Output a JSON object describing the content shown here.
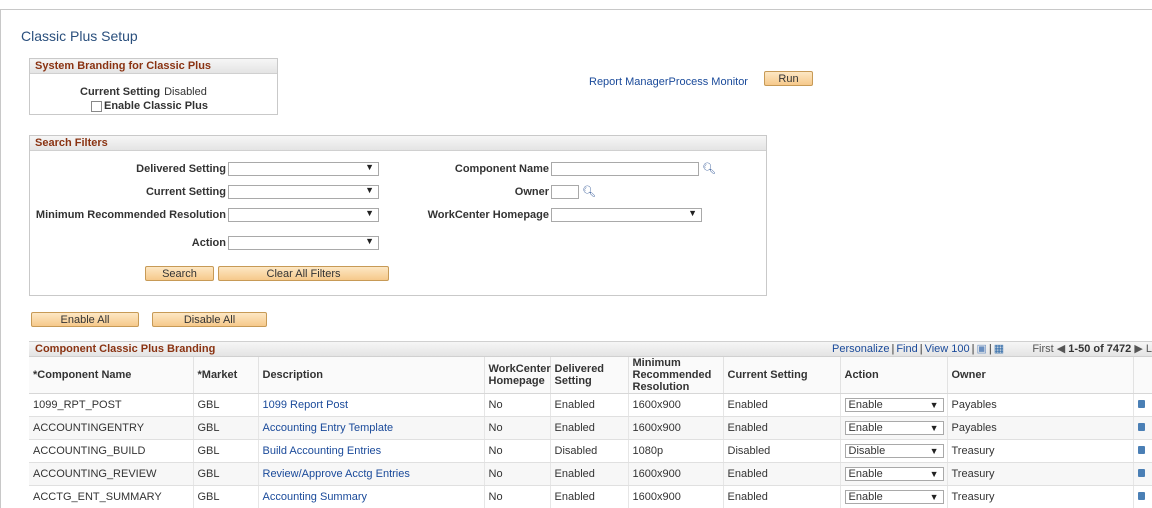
{
  "page": {
    "title": "Classic Plus Setup"
  },
  "branding": {
    "header": "System Branding for Classic Plus",
    "current_setting_label": "Current Setting",
    "current_setting_value": "Disabled",
    "enable_label": "Enable Classic Plus"
  },
  "links": {
    "report_manager": "Report Manager",
    "process_monitor": "Process Monitor"
  },
  "buttons": {
    "run": "Run",
    "search": "Search",
    "clear_all_filters": "Clear All Filters",
    "enable_all": "Enable All",
    "disable_all": "Disable All"
  },
  "filters": {
    "header": "Search Filters",
    "delivered_setting": "Delivered Setting",
    "current_setting": "Current Setting",
    "min_resolution": "Minimum Recommended Resolution",
    "action": "Action",
    "component_name": "Component Name",
    "owner": "Owner",
    "workcenter_homepage": "WorkCenter Homepage"
  },
  "grid": {
    "title": "Component Classic Plus Branding",
    "nav": {
      "personalize": "Personalize",
      "find": "Find",
      "view": "View 100",
      "first": "First",
      "range": "1-50 of 7472",
      "last": "L"
    },
    "columns": {
      "component_name": "*Component Name",
      "market": "*Market",
      "description": "Description",
      "workcenter_homepage": "WorkCenter Homepage",
      "delivered_setting": "Delivered Setting",
      "min_resolution": "Minimum Recommended Resolution",
      "current_setting": "Current Setting",
      "action": "Action",
      "owner": "Owner"
    },
    "rows": [
      {
        "component": "1099_RPT_POST",
        "market": "GBL",
        "description": "1099 Report Post",
        "workcenter": "No",
        "delivered": "Enabled",
        "resolution": "1600x900",
        "current": "Enabled",
        "action": "Enable",
        "owner": "Payables"
      },
      {
        "component": "ACCOUNTINGENTRY",
        "market": "GBL",
        "description": "Accounting Entry Template",
        "workcenter": "No",
        "delivered": "Enabled",
        "resolution": "1600x900",
        "current": "Enabled",
        "action": "Enable",
        "owner": "Payables"
      },
      {
        "component": "ACCOUNTING_BUILD",
        "market": "GBL",
        "description": "Build Accounting Entries",
        "workcenter": "No",
        "delivered": "Disabled",
        "resolution": "1080p",
        "current": "Disabled",
        "action": "Disable",
        "owner": "Treasury"
      },
      {
        "component": "ACCOUNTING_REVIEW",
        "market": "GBL",
        "description": "Review/Approve Acctg Entries",
        "workcenter": "No",
        "delivered": "Enabled",
        "resolution": "1600x900",
        "current": "Enabled",
        "action": "Enable",
        "owner": "Treasury"
      },
      {
        "component": "ACCTG_ENT_SUMMARY",
        "market": "GBL",
        "description": "Accounting Summary",
        "workcenter": "No",
        "delivered": "Enabled",
        "resolution": "1600x900",
        "current": "Enabled",
        "action": "Enable",
        "owner": "Treasury"
      }
    ]
  }
}
